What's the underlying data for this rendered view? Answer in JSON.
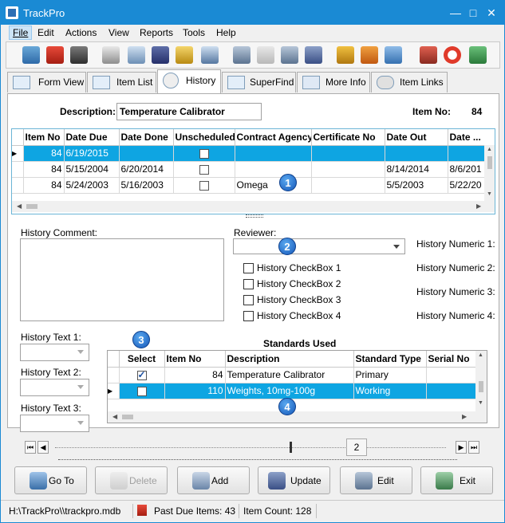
{
  "window": {
    "title": "TrackPro"
  },
  "menu": [
    "File",
    "Edit",
    "Actions",
    "View",
    "Reports",
    "Tools",
    "Help"
  ],
  "toolbar_icons": [
    "open-db-icon",
    "flag-icon",
    "binoculars-icon",
    "print-icon",
    "report-icon",
    "save-icon",
    "ruler-icon",
    "notebook-icon",
    "add-db-icon",
    "delete-db-icon",
    "db-check-icon",
    "db-save-icon",
    "import-icon",
    "export-icon",
    "screen-icon",
    "tools-icon",
    "help-ring-icon",
    "exit-icon"
  ],
  "tabs": [
    "Form View",
    "Item List",
    "History",
    "SuperFind",
    "More Info",
    "Item Links"
  ],
  "form": {
    "description_label": "Description:",
    "description_value": "Temperature Calibrator",
    "item_no_label": "Item No:",
    "item_no_value": "84"
  },
  "history_grid": {
    "columns": [
      "Item No",
      "Date Due",
      "Date Done",
      "Unscheduled",
      "Contract Agency",
      "Certificate No",
      "Date Out",
      "Date ..."
    ],
    "rows": [
      {
        "item_no": "84",
        "date_due": "6/19/2015",
        "date_done": "",
        "unscheduled": false,
        "agency": "",
        "cert": "",
        "date_out": "",
        "date_in": ""
      },
      {
        "item_no": "84",
        "date_due": "5/15/2004",
        "date_done": "6/20/2014",
        "unscheduled": false,
        "agency": "",
        "cert": "",
        "date_out": "8/14/2014",
        "date_in": "8/6/201"
      },
      {
        "item_no": "84",
        "date_due": "5/24/2003",
        "date_done": "5/16/2003",
        "unscheduled": false,
        "agency": "Omega",
        "cert": "",
        "date_out": "5/5/2003",
        "date_in": "5/22/20"
      }
    ]
  },
  "badges": [
    "1",
    "2",
    "3",
    "4"
  ],
  "history_comment_label": "History Comment:",
  "reviewer_label": "Reviewer:",
  "checkboxes": [
    "History CheckBox 1",
    "History CheckBox 2",
    "History CheckBox 3",
    "History CheckBox 4"
  ],
  "numerics": [
    "History Numeric 1:",
    "History Numeric 2:",
    "History Numeric 3:",
    "History Numeric 4:"
  ],
  "texts": [
    "History Text 1:",
    "History Text 2:",
    "History Text 3:"
  ],
  "standards": {
    "title": "Standards Used",
    "columns": [
      "Select",
      "Item No",
      "Description",
      "Standard Type",
      "Serial No"
    ],
    "rows": [
      {
        "select": true,
        "item_no": "84",
        "description": "Temperature Calibrator",
        "type": "Primary",
        "serial": ""
      },
      {
        "select": false,
        "item_no": "110",
        "description": "Weights, 10mg-100g",
        "type": "Working",
        "serial": ""
      }
    ]
  },
  "navigator": {
    "position": "2"
  },
  "buttons": [
    "Go To",
    "Delete",
    "Add",
    "Update",
    "Edit",
    "Exit"
  ],
  "status": {
    "path": "H:\\TrackPro\\\\trackpro.mdb",
    "past_due": "Past Due Items: 43",
    "count": "Item Count: 128"
  },
  "colors": {
    "title_bar": "#1a8ad4",
    "selection": "#0ea5e2",
    "badge": "#1557b8"
  }
}
